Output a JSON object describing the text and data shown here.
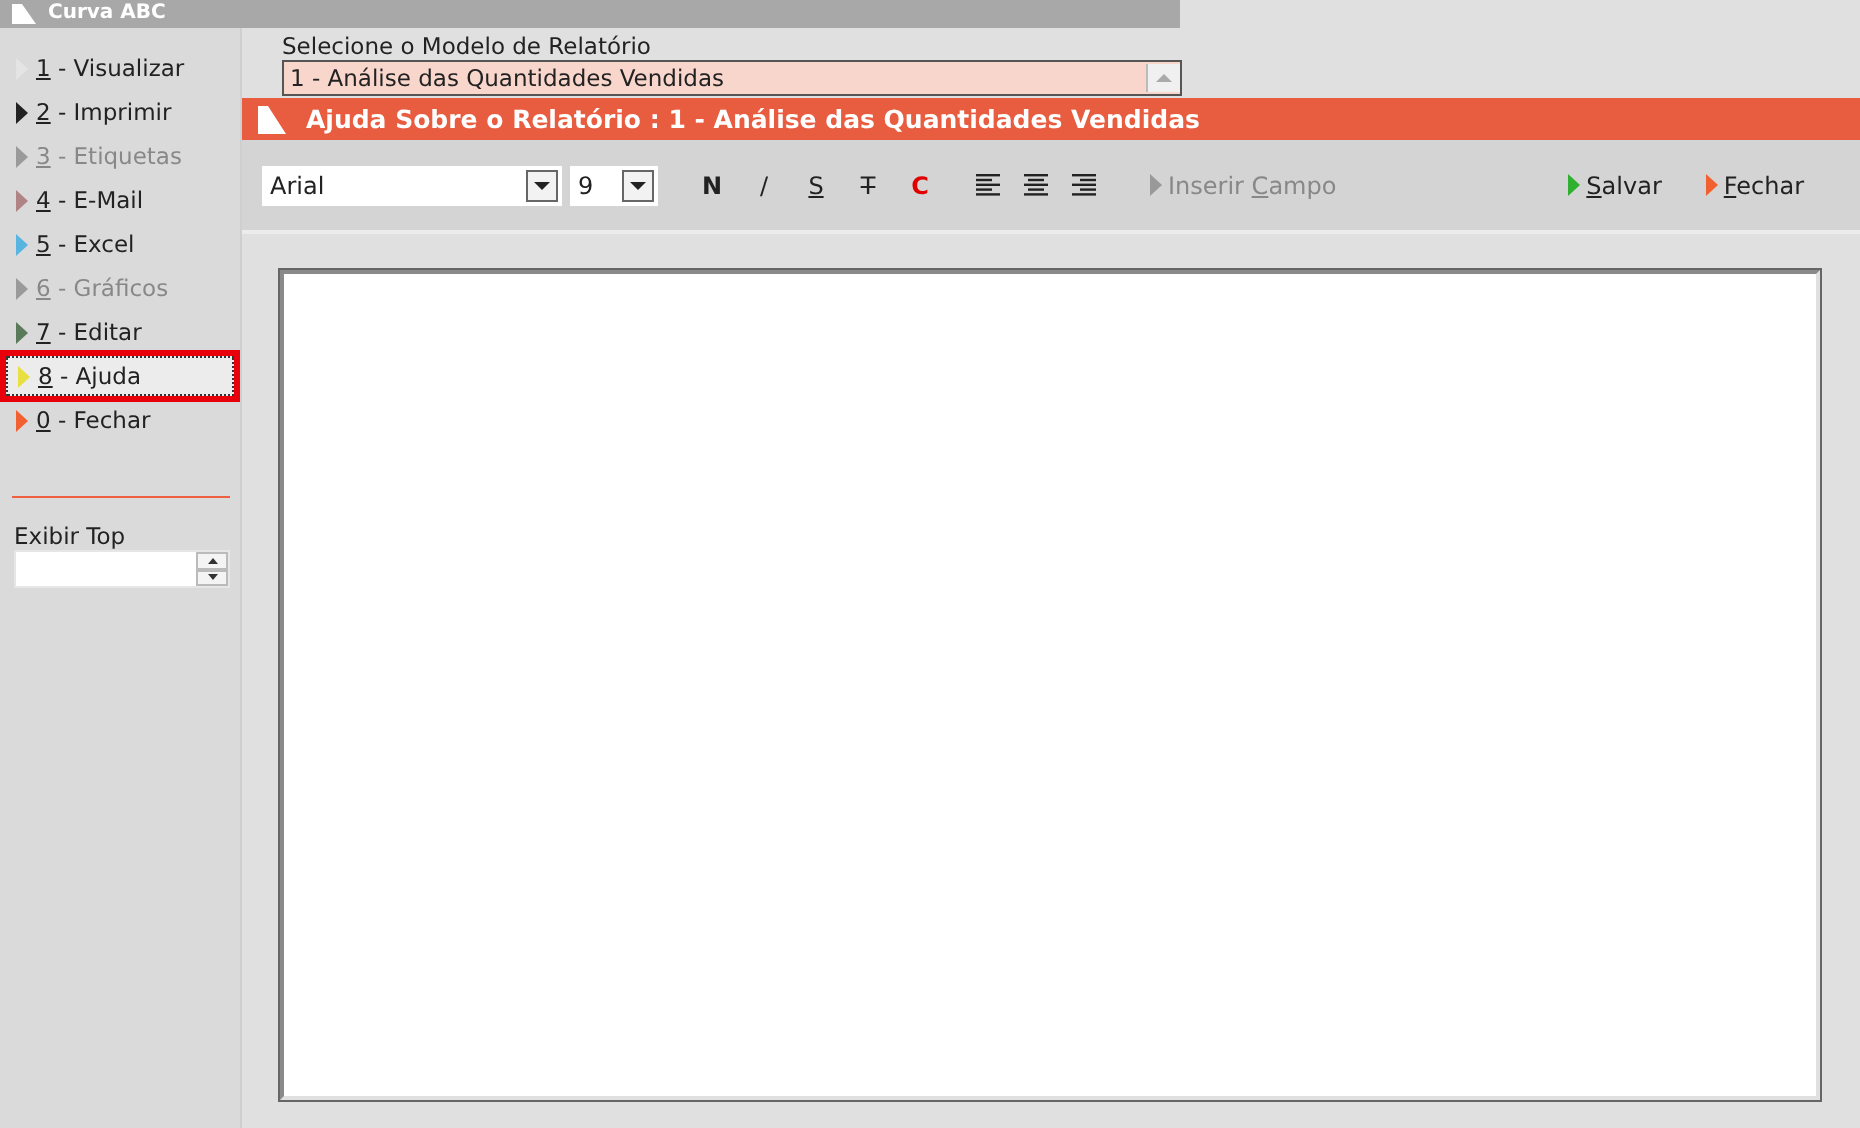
{
  "window": {
    "title": "Curva ABC"
  },
  "sidebar": {
    "items": [
      {
        "accel": "1",
        "rest": " - Visualizar",
        "color": "#e4e4e4",
        "disabled": false,
        "selected": false
      },
      {
        "accel": "2",
        "rest": " - Imprimir",
        "color": "#222222",
        "disabled": false,
        "selected": false
      },
      {
        "accel": "3",
        "rest": " - Etiquetas",
        "color": "#9a9a9a",
        "disabled": true,
        "selected": false
      },
      {
        "accel": "4",
        "rest": " - E-Mail",
        "color": "#b08484",
        "disabled": false,
        "selected": false
      },
      {
        "accel": "5",
        "rest": " - Excel",
        "color": "#5ab4e0",
        "disabled": false,
        "selected": false
      },
      {
        "accel": "6",
        "rest": " - Gráficos",
        "color": "#9a9a9a",
        "disabled": true,
        "selected": false
      },
      {
        "accel": "7",
        "rest": " - Editar",
        "color": "#5a7a5a",
        "disabled": false,
        "selected": false
      },
      {
        "accel": "8",
        "rest": " - Ajuda",
        "color": "#e8e040",
        "disabled": false,
        "selected": true
      },
      {
        "accel": "0",
        "rest": " - Fechar",
        "color": "#f06030",
        "disabled": false,
        "selected": false
      }
    ],
    "top_label": "Exibir Top"
  },
  "report_model": {
    "label": "Selecione o Modelo de Relatório",
    "value": "1 - Análise das Quantidades Vendidas"
  },
  "dialog": {
    "title": "Ajuda Sobre o Relatório : 1 - Análise das Quantidades Vendidas",
    "font": "Arial",
    "size": "9",
    "format_buttons": [
      {
        "label": "N",
        "kind": "bold"
      },
      {
        "label": "/",
        "kind": "italic"
      },
      {
        "label": "S",
        "kind": "underline"
      },
      {
        "label": "T",
        "kind": "strike"
      },
      {
        "label": "C",
        "kind": "color"
      }
    ],
    "align_buttons": [
      {
        "kind": "left"
      },
      {
        "kind": "center"
      },
      {
        "kind": "right"
      }
    ],
    "actions": [
      {
        "pre": "Inserir ",
        "accel": "C",
        "rest": "ampo",
        "color": "#999999",
        "disabled": true
      },
      {
        "accel": "S",
        "rest": "alvar",
        "color": "#30b030",
        "disabled": false
      },
      {
        "accel": "F",
        "rest": "echar",
        "color": "#f06030",
        "disabled": false
      }
    ]
  }
}
